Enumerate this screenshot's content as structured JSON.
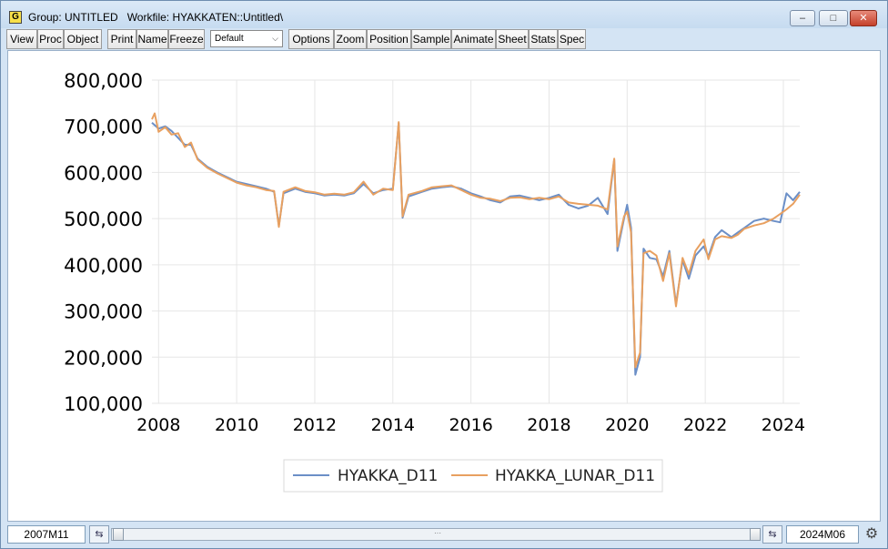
{
  "window": {
    "title": "Group: UNTITLED   Workfile: HYAKKATEN::Untitled\\",
    "app_icon": "G",
    "buttons": {
      "minimize": "–",
      "maximize": "□",
      "close": "✕"
    }
  },
  "toolbar": {
    "buttons": [
      "View",
      "Proc",
      "Object",
      "Print",
      "Name",
      "Freeze",
      "Options",
      "Zoom",
      "Position",
      "Sample",
      "Animate",
      "Sheet",
      "Stats",
      "Spec"
    ],
    "select_value": "Default"
  },
  "statusbar": {
    "start": "2007M11",
    "end": "2024M06",
    "thumb_grip": "···"
  },
  "chart_data": {
    "type": "line",
    "ylim": [
      100000,
      800000
    ],
    "yticks": [
      100000,
      200000,
      300000,
      400000,
      500000,
      600000,
      700000,
      800000
    ],
    "ytick_labels": [
      "100,000",
      "200,000",
      "300,000",
      "400,000",
      "500,000",
      "600,000",
      "700,000",
      "800,000"
    ],
    "xlim": [
      2007.83,
      2024.42
    ],
    "xticks": [
      2008,
      2010,
      2012,
      2014,
      2016,
      2018,
      2020,
      2022,
      2024
    ],
    "xtick_labels": [
      "2008",
      "2010",
      "2012",
      "2014",
      "2016",
      "2018",
      "2020",
      "2022",
      "2024"
    ],
    "grid": true,
    "legend_position": "bottom-center",
    "colors": {
      "HYAKKA_D11": "#6b8fc7",
      "HYAKKA_LUNAR_D11": "#e8a060"
    },
    "series": [
      {
        "name": "HYAKKA_D11",
        "points": [
          [
            2007.83,
            708000
          ],
          [
            2008.0,
            695000
          ],
          [
            2008.17,
            700000
          ],
          [
            2008.33,
            690000
          ],
          [
            2008.5,
            675000
          ],
          [
            2008.67,
            660000
          ],
          [
            2008.83,
            660000
          ],
          [
            2009.0,
            630000
          ],
          [
            2009.25,
            612000
          ],
          [
            2009.5,
            600000
          ],
          [
            2009.75,
            590000
          ],
          [
            2010.0,
            580000
          ],
          [
            2010.25,
            575000
          ],
          [
            2010.5,
            570000
          ],
          [
            2010.75,
            565000
          ],
          [
            2010.96,
            558000
          ],
          [
            2011.08,
            485000
          ],
          [
            2011.2,
            555000
          ],
          [
            2011.5,
            565000
          ],
          [
            2011.75,
            558000
          ],
          [
            2012.0,
            555000
          ],
          [
            2012.25,
            550000
          ],
          [
            2012.5,
            552000
          ],
          [
            2012.75,
            550000
          ],
          [
            2013.0,
            555000
          ],
          [
            2013.25,
            575000
          ],
          [
            2013.5,
            555000
          ],
          [
            2013.75,
            562000
          ],
          [
            2014.0,
            565000
          ],
          [
            2014.15,
            707000
          ],
          [
            2014.25,
            502000
          ],
          [
            2014.4,
            548000
          ],
          [
            2014.75,
            558000
          ],
          [
            2015.0,
            565000
          ],
          [
            2015.25,
            568000
          ],
          [
            2015.5,
            570000
          ],
          [
            2015.75,
            565000
          ],
          [
            2016.0,
            555000
          ],
          [
            2016.25,
            548000
          ],
          [
            2016.5,
            540000
          ],
          [
            2016.75,
            535000
          ],
          [
            2017.0,
            548000
          ],
          [
            2017.25,
            550000
          ],
          [
            2017.5,
            545000
          ],
          [
            2017.75,
            540000
          ],
          [
            2018.0,
            545000
          ],
          [
            2018.25,
            552000
          ],
          [
            2018.5,
            530000
          ],
          [
            2018.75,
            522000
          ],
          [
            2019.0,
            528000
          ],
          [
            2019.25,
            545000
          ],
          [
            2019.5,
            510000
          ],
          [
            2019.67,
            628000
          ],
          [
            2019.75,
            430000
          ],
          [
            2019.92,
            500000
          ],
          [
            2020.0,
            530000
          ],
          [
            2020.1,
            480000
          ],
          [
            2020.21,
            162000
          ],
          [
            2020.33,
            200000
          ],
          [
            2020.42,
            435000
          ],
          [
            2020.58,
            415000
          ],
          [
            2020.75,
            412000
          ],
          [
            2020.92,
            375000
          ],
          [
            2021.08,
            430000
          ],
          [
            2021.25,
            315000
          ],
          [
            2021.42,
            410000
          ],
          [
            2021.58,
            370000
          ],
          [
            2021.75,
            420000
          ],
          [
            2021.96,
            440000
          ],
          [
            2022.08,
            418000
          ],
          [
            2022.25,
            460000
          ],
          [
            2022.42,
            475000
          ],
          [
            2022.67,
            460000
          ],
          [
            2022.83,
            470000
          ],
          [
            2023.0,
            480000
          ],
          [
            2023.25,
            495000
          ],
          [
            2023.5,
            500000
          ],
          [
            2023.75,
            495000
          ],
          [
            2023.92,
            492000
          ],
          [
            2024.08,
            555000
          ],
          [
            2024.25,
            540000
          ],
          [
            2024.42,
            558000
          ]
        ]
      },
      {
        "name": "HYAKKA_LUNAR_D11",
        "points": [
          [
            2007.83,
            715000
          ],
          [
            2007.9,
            728000
          ],
          [
            2008.0,
            688000
          ],
          [
            2008.17,
            698000
          ],
          [
            2008.33,
            682000
          ],
          [
            2008.5,
            685000
          ],
          [
            2008.67,
            655000
          ],
          [
            2008.83,
            665000
          ],
          [
            2009.0,
            628000
          ],
          [
            2009.25,
            610000
          ],
          [
            2009.5,
            598000
          ],
          [
            2009.75,
            588000
          ],
          [
            2010.0,
            578000
          ],
          [
            2010.25,
            572000
          ],
          [
            2010.5,
            568000
          ],
          [
            2010.75,
            562000
          ],
          [
            2010.96,
            560000
          ],
          [
            2011.08,
            482000
          ],
          [
            2011.2,
            558000
          ],
          [
            2011.5,
            568000
          ],
          [
            2011.75,
            560000
          ],
          [
            2012.0,
            557000
          ],
          [
            2012.25,
            552000
          ],
          [
            2012.5,
            554000
          ],
          [
            2012.75,
            552000
          ],
          [
            2013.0,
            557000
          ],
          [
            2013.25,
            580000
          ],
          [
            2013.5,
            552000
          ],
          [
            2013.75,
            565000
          ],
          [
            2014.0,
            562000
          ],
          [
            2014.15,
            709000
          ],
          [
            2014.25,
            505000
          ],
          [
            2014.4,
            552000
          ],
          [
            2014.75,
            560000
          ],
          [
            2015.0,
            568000
          ],
          [
            2015.25,
            570000
          ],
          [
            2015.5,
            572000
          ],
          [
            2015.75,
            562000
          ],
          [
            2016.0,
            552000
          ],
          [
            2016.25,
            545000
          ],
          [
            2016.5,
            543000
          ],
          [
            2016.75,
            538000
          ],
          [
            2017.0,
            545000
          ],
          [
            2017.25,
            546000
          ],
          [
            2017.5,
            542000
          ],
          [
            2017.75,
            545000
          ],
          [
            2018.0,
            542000
          ],
          [
            2018.25,
            548000
          ],
          [
            2018.5,
            535000
          ],
          [
            2018.75,
            532000
          ],
          [
            2019.0,
            530000
          ],
          [
            2019.25,
            528000
          ],
          [
            2019.5,
            520000
          ],
          [
            2019.67,
            630000
          ],
          [
            2019.75,
            440000
          ],
          [
            2019.92,
            505000
          ],
          [
            2020.0,
            515000
          ],
          [
            2020.1,
            470000
          ],
          [
            2020.21,
            178000
          ],
          [
            2020.33,
            210000
          ],
          [
            2020.42,
            425000
          ],
          [
            2020.58,
            430000
          ],
          [
            2020.75,
            420000
          ],
          [
            2020.92,
            365000
          ],
          [
            2021.08,
            425000
          ],
          [
            2021.25,
            310000
          ],
          [
            2021.42,
            415000
          ],
          [
            2021.58,
            380000
          ],
          [
            2021.75,
            430000
          ],
          [
            2021.96,
            455000
          ],
          [
            2022.08,
            412000
          ],
          [
            2022.25,
            455000
          ],
          [
            2022.42,
            462000
          ],
          [
            2022.67,
            458000
          ],
          [
            2022.83,
            465000
          ],
          [
            2023.0,
            478000
          ],
          [
            2023.25,
            485000
          ],
          [
            2023.5,
            490000
          ],
          [
            2023.75,
            500000
          ],
          [
            2023.92,
            510000
          ],
          [
            2024.08,
            520000
          ],
          [
            2024.25,
            532000
          ],
          [
            2024.42,
            552000
          ]
        ]
      }
    ]
  }
}
